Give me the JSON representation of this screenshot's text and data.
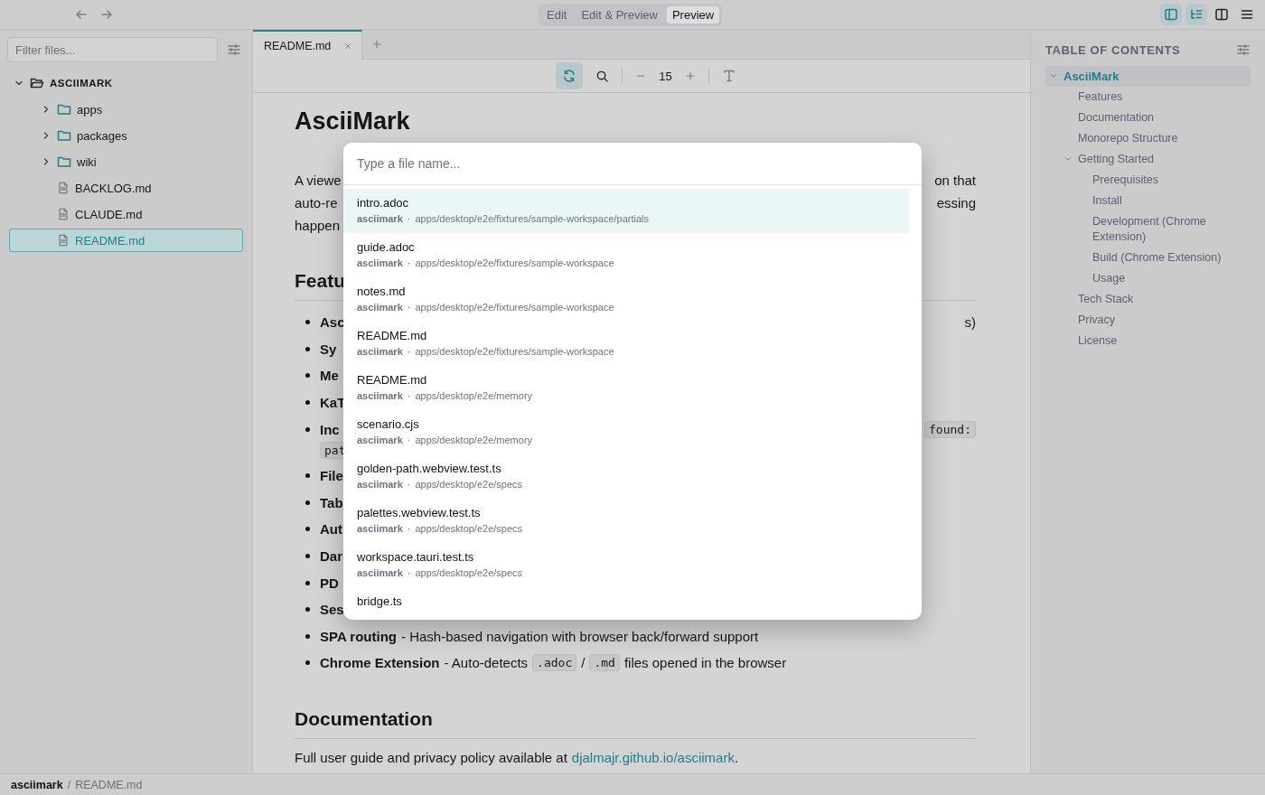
{
  "top_bar": {
    "modes": [
      {
        "label": "Edit",
        "selected": false
      },
      {
        "label": "Edit & Preview",
        "selected": false
      },
      {
        "label": "Preview",
        "selected": true
      }
    ],
    "panel_toggles": [
      {
        "kind": "sidebar",
        "on": true
      },
      {
        "kind": "toc",
        "on": true
      },
      {
        "kind": "split",
        "on": false
      },
      {
        "kind": "menu",
        "on": false
      }
    ]
  },
  "sidebar": {
    "filter": {
      "placeholder": "Filter files..."
    },
    "tree": [
      {
        "label": "ASCIIMARK",
        "kind": "root",
        "expanded": true,
        "selected": false,
        "children": [
          {
            "label": "apps",
            "kind": "folder",
            "expanded": false,
            "selected": false
          },
          {
            "label": "packages",
            "kind": "folder",
            "expanded": false,
            "selected": false
          },
          {
            "label": "wiki",
            "kind": "folder",
            "expanded": false,
            "selected": false
          },
          {
            "label": "BACKLOG.md",
            "kind": "file",
            "selected": false
          },
          {
            "label": "CLAUDE.md",
            "kind": "file",
            "selected": false
          },
          {
            "label": "README.md",
            "kind": "file",
            "selected": true
          }
        ]
      }
    ]
  },
  "tabs": [
    {
      "label": "README.md",
      "selected": true
    }
  ],
  "preview_toolbar": {
    "sync_on": true,
    "font_size": "15"
  },
  "document": {
    "heading": "AsciiMark",
    "intro_lines": [
      {
        "left": "A viewe",
        "right": "on that"
      },
      {
        "left": "auto-re",
        "right": "essing"
      },
      {
        "left": "happen"
      }
    ],
    "sections": [
      {
        "heading": "Featu",
        "bullets": [
          {
            "left": [
              {
                "kind": "bold",
                "text": "Asc"
              }
            ],
            "right": [
              {
                "kind": "text",
                "text": "s)"
              }
            ]
          },
          {
            "left": [
              {
                "kind": "bold",
                "text": "Sy"
              }
            ]
          },
          {
            "left": [
              {
                "kind": "bold",
                "text": "Me"
              }
            ]
          },
          {
            "left": [
              {
                "kind": "bold",
                "text": "KaT"
              }
            ]
          },
          {
            "left": [
              {
                "kind": "bold",
                "text": "Inc"
              }
            ],
            "right": [
              {
                "kind": "code",
                "text": "found:"
              }
            ],
            "continuation": [
              {
                "kind": "code",
                "text": "pat"
              }
            ]
          },
          {
            "left": [
              {
                "kind": "bold",
                "text": "File"
              }
            ]
          },
          {
            "left": [
              {
                "kind": "bold",
                "text": "Tab"
              }
            ]
          },
          {
            "left": [
              {
                "kind": "bold",
                "text": "Aut"
              }
            ]
          },
          {
            "left": [
              {
                "kind": "bold",
                "text": "Dar"
              }
            ]
          },
          {
            "left": [
              {
                "kind": "bold",
                "text": "PD"
              }
            ]
          },
          {
            "left": [
              {
                "kind": "bold",
                "text": "Ses"
              }
            ]
          },
          {
            "left": [
              {
                "kind": "bold",
                "text": "SPA routing"
              },
              {
                "kind": "text",
                "text": "- Hash-based navigation with browser back/forward support"
              }
            ]
          },
          {
            "left": [
              {
                "kind": "bold",
                "text": "Chrome Extension"
              },
              {
                "kind": "text",
                "text": "- Auto-detects"
              },
              {
                "kind": "code",
                "text": ".adoc"
              },
              {
                "kind": "text",
                "text": "/"
              },
              {
                "kind": "code",
                "text": ".md"
              },
              {
                "kind": "text",
                "text": "files opened in the browser"
              }
            ]
          }
        ]
      },
      {
        "heading": "Documentation",
        "paragraph": [
          {
            "kind": "text",
            "text": "Full user guide and privacy policy available at"
          },
          {
            "kind": "link",
            "text": "djalmajr.github.io/asciimark"
          },
          {
            "kind": "text",
            "text": "."
          }
        ]
      }
    ]
  },
  "quick_open": {
    "placeholder": "Type a file name...",
    "results": [
      {
        "name": "intro.adoc",
        "repo": "asciimark",
        "separator": "·",
        "path": "apps/desktop/e2e/fixtures/sample-workspace/partials",
        "selected": true
      },
      {
        "name": "guide.adoc",
        "repo": "asciimark",
        "separator": "·",
        "path": "apps/desktop/e2e/fixtures/sample-workspace",
        "selected": false
      },
      {
        "name": "notes.md",
        "repo": "asciimark",
        "separator": "·",
        "path": "apps/desktop/e2e/fixtures/sample-workspace",
        "selected": false
      },
      {
        "name": "README.md",
        "repo": "asciimark",
        "separator": "·",
        "path": "apps/desktop/e2e/fixtures/sample-workspace",
        "selected": false
      },
      {
        "name": "README.md",
        "repo": "asciimark",
        "separator": "·",
        "path": "apps/desktop/e2e/memory",
        "selected": false
      },
      {
        "name": "scenario.cjs",
        "repo": "asciimark",
        "separator": "·",
        "path": "apps/desktop/e2e/memory",
        "selected": false
      },
      {
        "name": "golden-path.webview.test.ts",
        "repo": "asciimark",
        "separator": "·",
        "path": "apps/desktop/e2e/specs",
        "selected": false
      },
      {
        "name": "palettes.webview.test.ts",
        "repo": "asciimark",
        "separator": "·",
        "path": "apps/desktop/e2e/specs",
        "selected": false
      },
      {
        "name": "workspace.tauri.test.ts",
        "repo": "asciimark",
        "separator": "·",
        "path": "apps/desktop/e2e/specs",
        "selected": false
      },
      {
        "name": "bridge.ts",
        "selected": false
      }
    ]
  },
  "toc": {
    "title": "TABLE OF CONTENTS",
    "items": [
      {
        "label": "AsciiMark",
        "selected": true,
        "expanded": true,
        "children": [
          {
            "label": "Features",
            "selected": false
          },
          {
            "label": "Documentation",
            "selected": false
          },
          {
            "label": "Monorepo Structure",
            "selected": false
          },
          {
            "label": "Getting Started",
            "selected": false,
            "expanded": true,
            "children": [
              {
                "label": "Prerequisites",
                "selected": false
              },
              {
                "label": "Install",
                "selected": false
              },
              {
                "label": "Development (Chrome Extension)",
                "selected": false
              },
              {
                "label": "Build (Chrome Extension)",
                "selected": false
              },
              {
                "label": "Usage",
                "selected": false
              }
            ]
          },
          {
            "label": "Tech Stack",
            "selected": false
          },
          {
            "label": "Privacy",
            "selected": false
          },
          {
            "label": "License",
            "selected": false
          }
        ]
      }
    ]
  },
  "status_bar": {
    "repo": "asciimark",
    "separator": "/",
    "file": "README.md"
  }
}
